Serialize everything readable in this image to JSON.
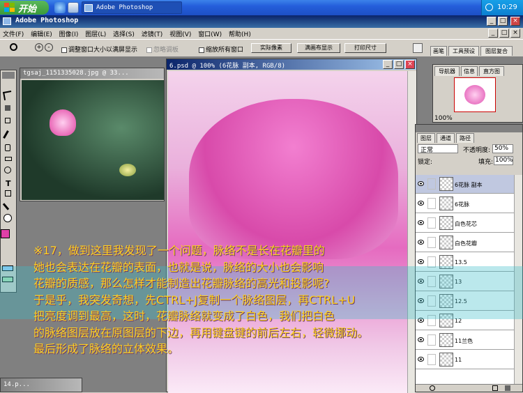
{
  "taskbar": {
    "start_label": "开始",
    "task_label": "Adobe Photoshop",
    "clock": "10:29"
  },
  "app": {
    "title": "Adobe Photoshop"
  },
  "menu": [
    "文件(F)",
    "编辑(E)",
    "图像(I)",
    "图层(L)",
    "选择(S)",
    "滤镜(T)",
    "视图(V)",
    "窗口(W)",
    "帮助(H)"
  ],
  "options": {
    "resize_window": "调整窗口大小以满屏显示",
    "ignore_palettes": "忽略调板",
    "zoom_all": "缩放所有窗口",
    "actual_pixels": "实际像素",
    "fit_screen": "满画布显示",
    "print_size": "打印尺寸"
  },
  "palette_tabs": [
    "画笔",
    "工具预设",
    "图层复合"
  ],
  "nav_tabs": [
    "导航器",
    "信息",
    "直方图"
  ],
  "nav_zoom": "100%",
  "doc1": {
    "title": "tgsaj_1151335028.jpg @ 33..."
  },
  "doc2": {
    "title": "6.psd @ 100% (6花脉 副本, RGB/8)"
  },
  "doc3": {
    "title": "14.p..."
  },
  "layers": {
    "tabs": [
      "图层",
      "通道",
      "路径"
    ],
    "blend_mode": "正常",
    "opacity_label": "不透明度:",
    "opacity_value": "50%",
    "lock_label": "锁定:",
    "fill_label": "填充:",
    "fill_value": "100%",
    "items": [
      "6花脉 副本",
      "6花脉",
      "白色花芯",
      "白色花瓣",
      "13.5",
      "13",
      "12.5",
      "12",
      "11兰色",
      "11"
    ]
  },
  "overlay_text": [
    "※17，做到这里我发现了一个问题，脉络不是长在花瓣里的",
    "她也会表达在花瓣的表面，也就是说，脉络的大小也会影响",
    "花瓣的质感，那么怎样才能制造出花瓣脉络的高光和投影呢?",
    "于是乎，我突发奇想，先CTRL+J复制一个脉络图层，再CTRL+U",
    "把亮度调到最高，这时，花瓣脉络就变成了白色，我们把白色",
    "的脉络图层放在原图层的下边，再用键盘键的前后左右，轻微挪动。",
    "最后形成了脉络的立体效果。"
  ]
}
